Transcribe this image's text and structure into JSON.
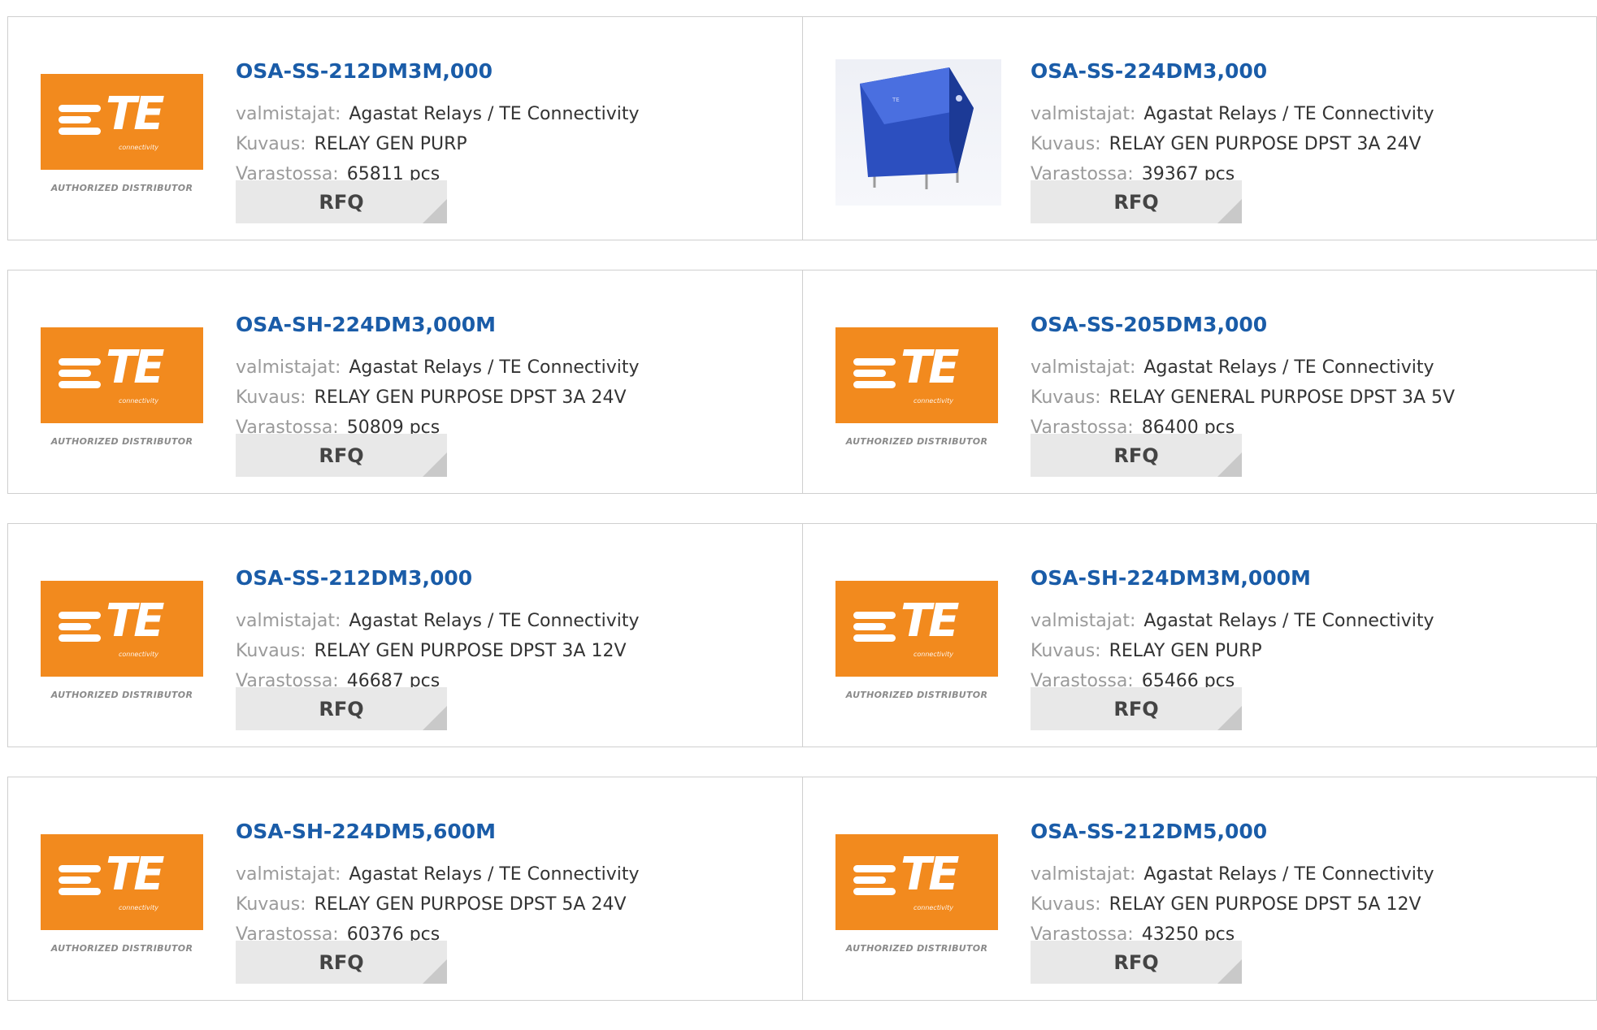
{
  "labels": {
    "manufacturer": "valmistajat:",
    "description": "Kuvaus:",
    "stock": "Varastossa:",
    "rfq": "RFQ"
  },
  "logo": {
    "text": "TE",
    "subtext": "connectivity",
    "authorized": "AUTHORIZED DISTRIBUTOR",
    "color": "#f28a1e"
  },
  "products": [
    {
      "part": "OSA-SS-212DM3M,000",
      "manufacturer": "Agastat Relays / TE Connectivity",
      "description": "RELAY GEN PURP",
      "stock": "65811 pcs",
      "image": "te-logo"
    },
    {
      "part": "OSA-SS-224DM3,000",
      "manufacturer": "Agastat Relays / TE Connectivity",
      "description": "RELAY GEN PURPOSE DPST 3A 24V",
      "stock": "39367 pcs",
      "image": "relay-photo"
    },
    {
      "part": "OSA-SH-224DM3,000M",
      "manufacturer": "Agastat Relays / TE Connectivity",
      "description": "RELAY GEN PURPOSE DPST 3A 24V",
      "stock": "50809 pcs",
      "image": "te-logo"
    },
    {
      "part": "OSA-SS-205DM3,000",
      "manufacturer": "Agastat Relays / TE Connectivity",
      "description": "RELAY GENERAL PURPOSE DPST 3A 5V",
      "stock": "86400 pcs",
      "image": "te-logo"
    },
    {
      "part": "OSA-SS-212DM3,000",
      "manufacturer": "Agastat Relays / TE Connectivity",
      "description": "RELAY GEN PURPOSE DPST 3A 12V",
      "stock": "46687 pcs",
      "image": "te-logo"
    },
    {
      "part": "OSA-SH-224DM3M,000M",
      "manufacturer": "Agastat Relays / TE Connectivity",
      "description": "RELAY GEN PURP",
      "stock": "65466 pcs",
      "image": "te-logo"
    },
    {
      "part": "OSA-SH-224DM5,600M",
      "manufacturer": "Agastat Relays / TE Connectivity",
      "description": "RELAY GEN PURPOSE DPST 5A 24V",
      "stock": "60376 pcs",
      "image": "te-logo"
    },
    {
      "part": "OSA-SS-212DM5,000",
      "manufacturer": "Agastat Relays / TE Connectivity",
      "description": "RELAY GEN PURPOSE DPST 5A 12V",
      "stock": "43250 pcs",
      "image": "te-logo"
    }
  ]
}
